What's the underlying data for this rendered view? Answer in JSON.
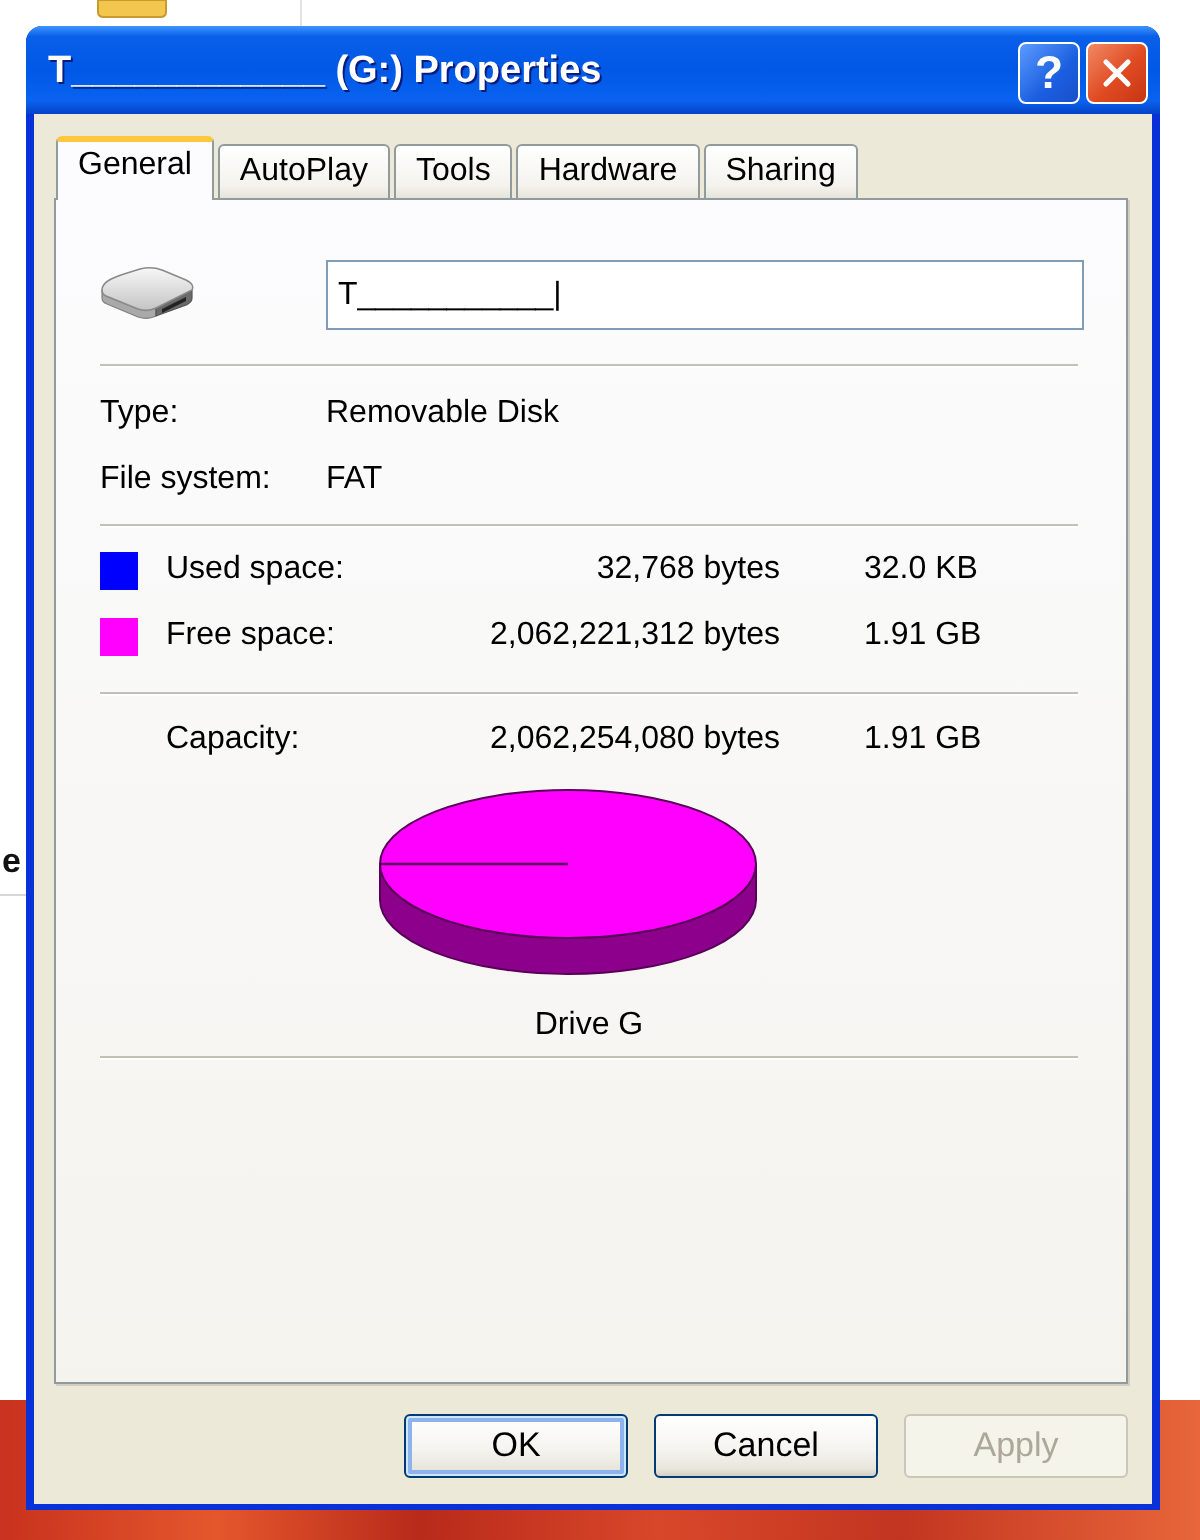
{
  "background_window": {
    "heading_fragment": "e"
  },
  "window": {
    "title": "T____________ (G:) Properties",
    "help_label": "?"
  },
  "tabs": [
    {
      "label": "General",
      "selected": true
    },
    {
      "label": "AutoPlay",
      "selected": false
    },
    {
      "label": "Tools",
      "selected": false
    },
    {
      "label": "Hardware",
      "selected": false
    },
    {
      "label": "Sharing",
      "selected": false
    }
  ],
  "name_field": {
    "value": "T___________|"
  },
  "properties": [
    {
      "label": "Type:",
      "value": "Removable Disk"
    },
    {
      "label": "File system:",
      "value": "FAT"
    }
  ],
  "spaces": [
    {
      "label": "Used space:",
      "bytes": "32,768 bytes",
      "size": "32.0 KB",
      "color": "#0000ff"
    },
    {
      "label": "Free space:",
      "bytes": "2,062,221,312 bytes",
      "size": "1.91 GB",
      "color": "#ff00ff"
    }
  ],
  "capacity": {
    "label": "Capacity:",
    "bytes": "2,062,254,080 bytes",
    "size": "1.91 GB"
  },
  "pie_label": "Drive G",
  "buttons": [
    {
      "label": "OK",
      "default": true,
      "disabled": false
    },
    {
      "label": "Cancel",
      "default": false,
      "disabled": false
    },
    {
      "label": "Apply",
      "default": false,
      "disabled": true
    }
  ]
}
